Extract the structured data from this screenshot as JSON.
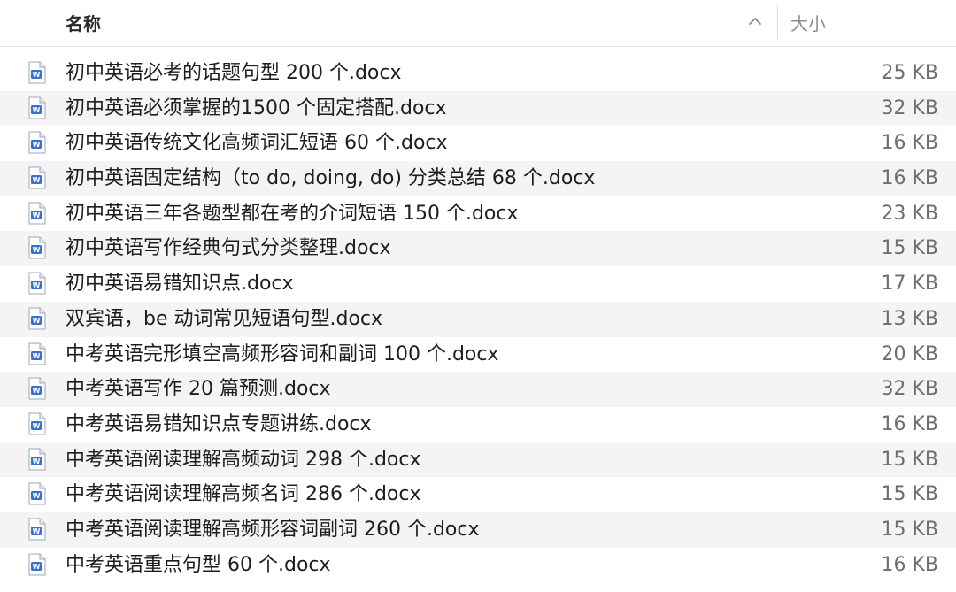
{
  "header": {
    "name_label": "名称",
    "size_label": "大小",
    "sort_icon": "chevron-up-icon"
  },
  "colors": {
    "doc_icon_blue": "#3b6fd4",
    "row_alt": "#f4f4f4",
    "size_text": "#6e6e6e"
  },
  "files": [
    {
      "name": "初中英语必考的话题句型 200 个.docx",
      "size": "25 KB",
      "icon": "word-doc-icon"
    },
    {
      "name": "初中英语必须掌握的1500 个固定搭配.docx",
      "size": "32 KB",
      "icon": "word-doc-icon"
    },
    {
      "name": "初中英语传统文化高频词汇短语 60 个.docx",
      "size": "16 KB",
      "icon": "word-doc-icon"
    },
    {
      "name": "初中英语固定结构（to do, doing, do) 分类总结 68 个.docx",
      "size": "16 KB",
      "icon": "word-doc-icon"
    },
    {
      "name": "初中英语三年各题型都在考的介词短语 150 个.docx",
      "size": "23 KB",
      "icon": "word-doc-icon"
    },
    {
      "name": "初中英语写作经典句式分类整理.docx",
      "size": "15 KB",
      "icon": "word-doc-icon"
    },
    {
      "name": "初中英语易错知识点.docx",
      "size": "17 KB",
      "icon": "word-doc-icon"
    },
    {
      "name": "双宾语，be 动词常见短语句型.docx",
      "size": "13 KB",
      "icon": "word-doc-icon"
    },
    {
      "name": "中考英语完形填空高频形容词和副词 100 个.docx",
      "size": "20 KB",
      "icon": "word-doc-icon"
    },
    {
      "name": "中考英语写作 20 篇预测.docx",
      "size": "32 KB",
      "icon": "word-doc-icon"
    },
    {
      "name": "中考英语易错知识点专题讲练.docx",
      "size": "16 KB",
      "icon": "word-doc-icon"
    },
    {
      "name": "中考英语阅读理解高频动词 298 个.docx",
      "size": "15 KB",
      "icon": "word-doc-icon"
    },
    {
      "name": "中考英语阅读理解高频名词 286 个.docx",
      "size": "15 KB",
      "icon": "word-doc-icon"
    },
    {
      "name": "中考英语阅读理解高频形容词副词 260 个.docx",
      "size": "15 KB",
      "icon": "word-doc-icon"
    },
    {
      "name": "中考英语重点句型 60 个.docx",
      "size": "16 KB",
      "icon": "word-doc-icon"
    }
  ]
}
